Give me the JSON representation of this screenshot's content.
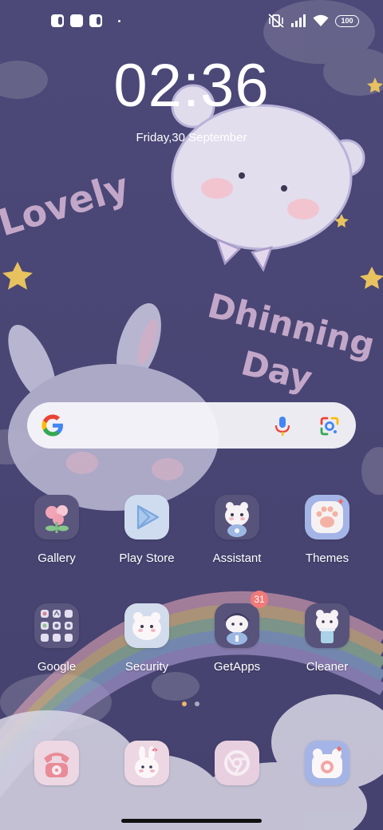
{
  "wallpaper": {
    "text_lovely": "Lovely",
    "text_dhinning": "Dhinning",
    "text_day": "Day"
  },
  "status_bar": {
    "battery": "100",
    "icons": [
      "app-notification-icon",
      "app-notification-icon",
      "app-notification-icon",
      "mute-vibrate-icon",
      "signal-icon",
      "wifi-icon",
      "battery-icon"
    ]
  },
  "clock": {
    "time": "02:36",
    "date": "Friday,30 September"
  },
  "search": {
    "icons": [
      "google-logo-icon",
      "microphone-icon",
      "google-lens-icon"
    ]
  },
  "apps": [
    {
      "label": "Gallery"
    },
    {
      "label": "Play Store"
    },
    {
      "label": "Assistant"
    },
    {
      "label": "Themes"
    },
    {
      "label": "Google"
    },
    {
      "label": "Security"
    },
    {
      "label": "GetApps",
      "badge": "31"
    },
    {
      "label": "Cleaner"
    }
  ],
  "dock": {
    "icons": [
      "phone-icon",
      "messaging-icon",
      "chrome-icon",
      "camera-icon"
    ]
  },
  "page_indicator": {
    "page": 1,
    "count": 2
  },
  "colors": {
    "background": "#4b4775",
    "tile": "#e2ddf2",
    "badge": "#f07a7a",
    "active_dot": "#f2b36b"
  }
}
